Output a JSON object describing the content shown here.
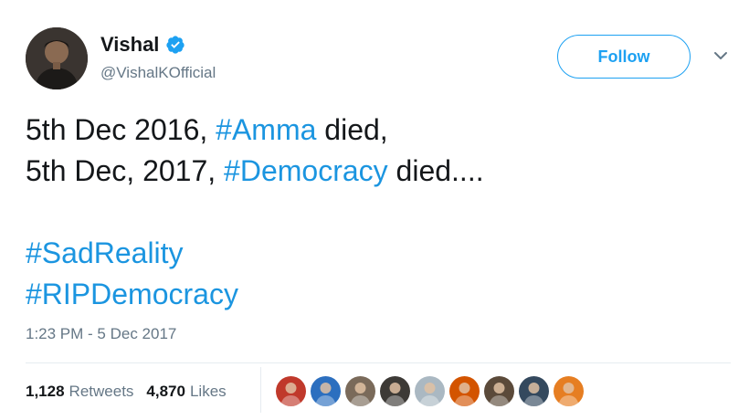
{
  "tweet": {
    "author": {
      "display_name": "Vishal",
      "handle": "@VishalKOfficial",
      "verified": true,
      "avatar_icon": "profile-photo"
    },
    "follow_label": "Follow",
    "menu_icon": "chevron-down-icon",
    "text": {
      "line1_a": "5th Dec 2016, ",
      "line1_tag": "#Amma",
      "line1_b": " died,",
      "line2_a": "5th Dec, 2017, ",
      "line2_tag": "#Democracy",
      "line2_b": " died....",
      "tag3": "#SadReality",
      "tag4": "#RIPDemocracy"
    },
    "timestamp": "1:23 PM - 5 Dec 2017",
    "stats": {
      "retweets_count": "1,128",
      "retweets_label": "Retweets",
      "likes_count": "4,870",
      "likes_label": "Likes"
    },
    "likers": [
      {
        "color": "#c0392b"
      },
      {
        "color": "#2c6fbf"
      },
      {
        "color": "#7a6a5a"
      },
      {
        "color": "#3d3a36"
      },
      {
        "color": "#aab8c2"
      },
      {
        "color": "#d35400"
      },
      {
        "color": "#5b4a3a"
      },
      {
        "color": "#34495e"
      },
      {
        "color": "#e67e22"
      }
    ]
  },
  "colors": {
    "accent": "#1da1f2",
    "hashtag": "#1b95e0",
    "secondary_text": "#657786",
    "primary_text": "#14171a"
  }
}
